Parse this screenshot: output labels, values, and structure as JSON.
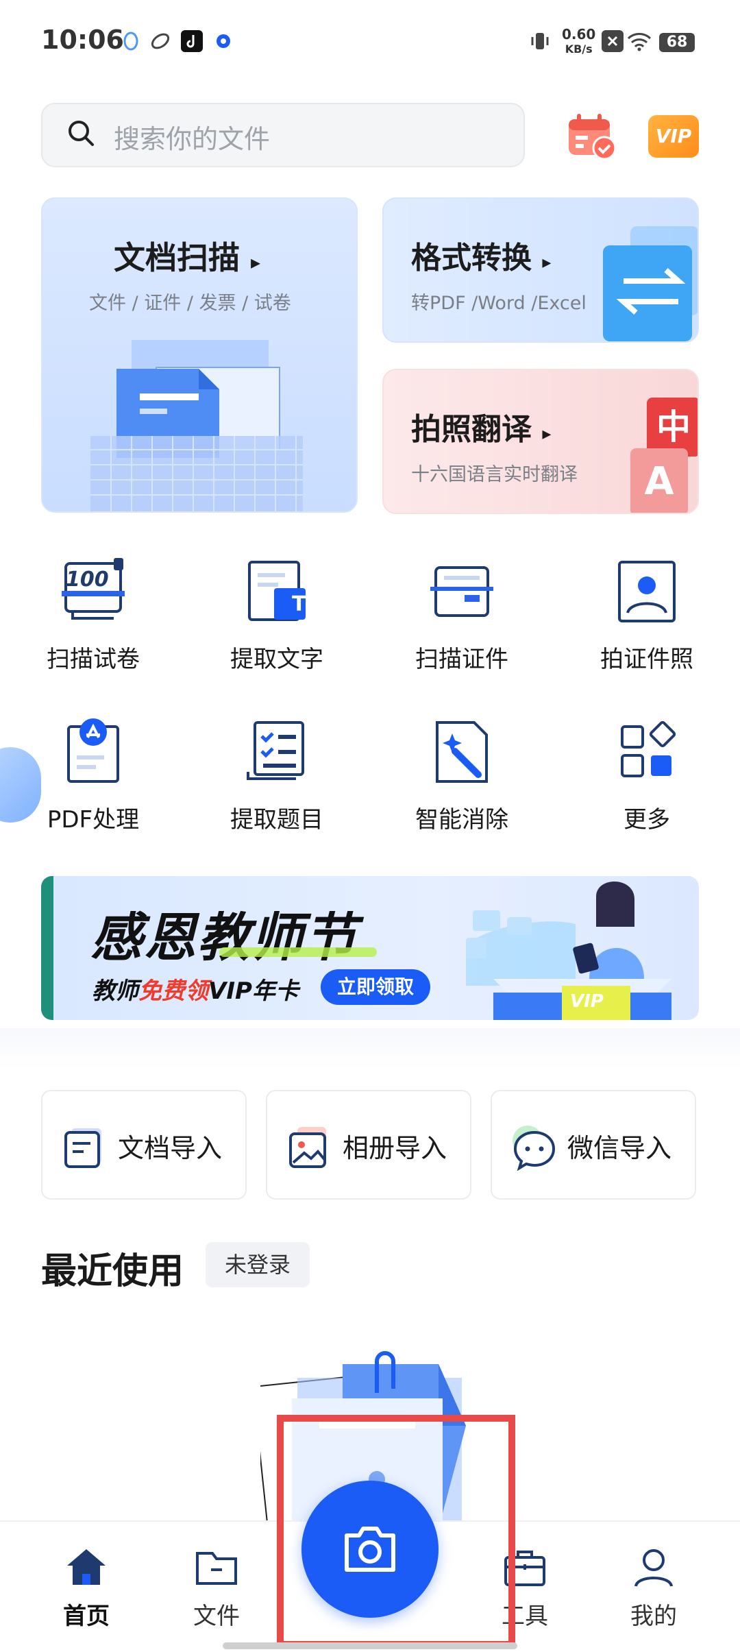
{
  "status_bar": {
    "time": "10:06",
    "speed_value": "0.60",
    "speed_unit": "KB/s",
    "battery": "68"
  },
  "search": {
    "placeholder": "搜索你的文件"
  },
  "header": {
    "vip_label": "VIP"
  },
  "cards": {
    "scan": {
      "title": "文档扫描",
      "subtitle": "文件 / 证件 / 发票 / 试卷"
    },
    "convert": {
      "title": "格式转换",
      "subtitle": "转PDF /Word /Excel"
    },
    "translate": {
      "title": "拍照翻译",
      "subtitle": "十六国语言实时翻译",
      "glyph_zh": "中",
      "glyph_a": "A"
    }
  },
  "tools": [
    {
      "label": "扫描试卷",
      "icon": "exam-paper-icon",
      "badge": "100"
    },
    {
      "label": "提取文字",
      "icon": "text-extract-icon",
      "badge": "T"
    },
    {
      "label": "扫描证件",
      "icon": "id-card-scan-icon"
    },
    {
      "label": "拍证件照",
      "icon": "id-photo-icon"
    },
    {
      "label": "PDF处理",
      "icon": "pdf-icon"
    },
    {
      "label": "提取题目",
      "icon": "question-extract-icon"
    },
    {
      "label": "智能消除",
      "icon": "magic-erase-icon"
    },
    {
      "label": "更多",
      "icon": "more-grid-icon"
    }
  ],
  "banner": {
    "title": "感恩教师节",
    "line_prefix": "教师",
    "line_highlight": "免费领",
    "line_suffix": "VIP年卡",
    "button": "立即领取",
    "desk_label": "VIP"
  },
  "imports": [
    {
      "label": "文档导入",
      "icon": "document-import-icon"
    },
    {
      "label": "相册导入",
      "icon": "album-import-icon"
    },
    {
      "label": "微信导入",
      "icon": "wechat-import-icon"
    }
  ],
  "recent": {
    "title": "最近使用",
    "badge": "未登录"
  },
  "nav": [
    {
      "label": "首页",
      "icon": "home-icon"
    },
    {
      "label": "文件",
      "icon": "folder-icon"
    },
    {
      "label": "工具",
      "icon": "toolbox-icon"
    },
    {
      "label": "我的",
      "icon": "profile-icon"
    }
  ],
  "colors": {
    "accent": "#1a5cf5",
    "highlight_box": "#e84a4a",
    "discount_red": "#f03a2a"
  }
}
